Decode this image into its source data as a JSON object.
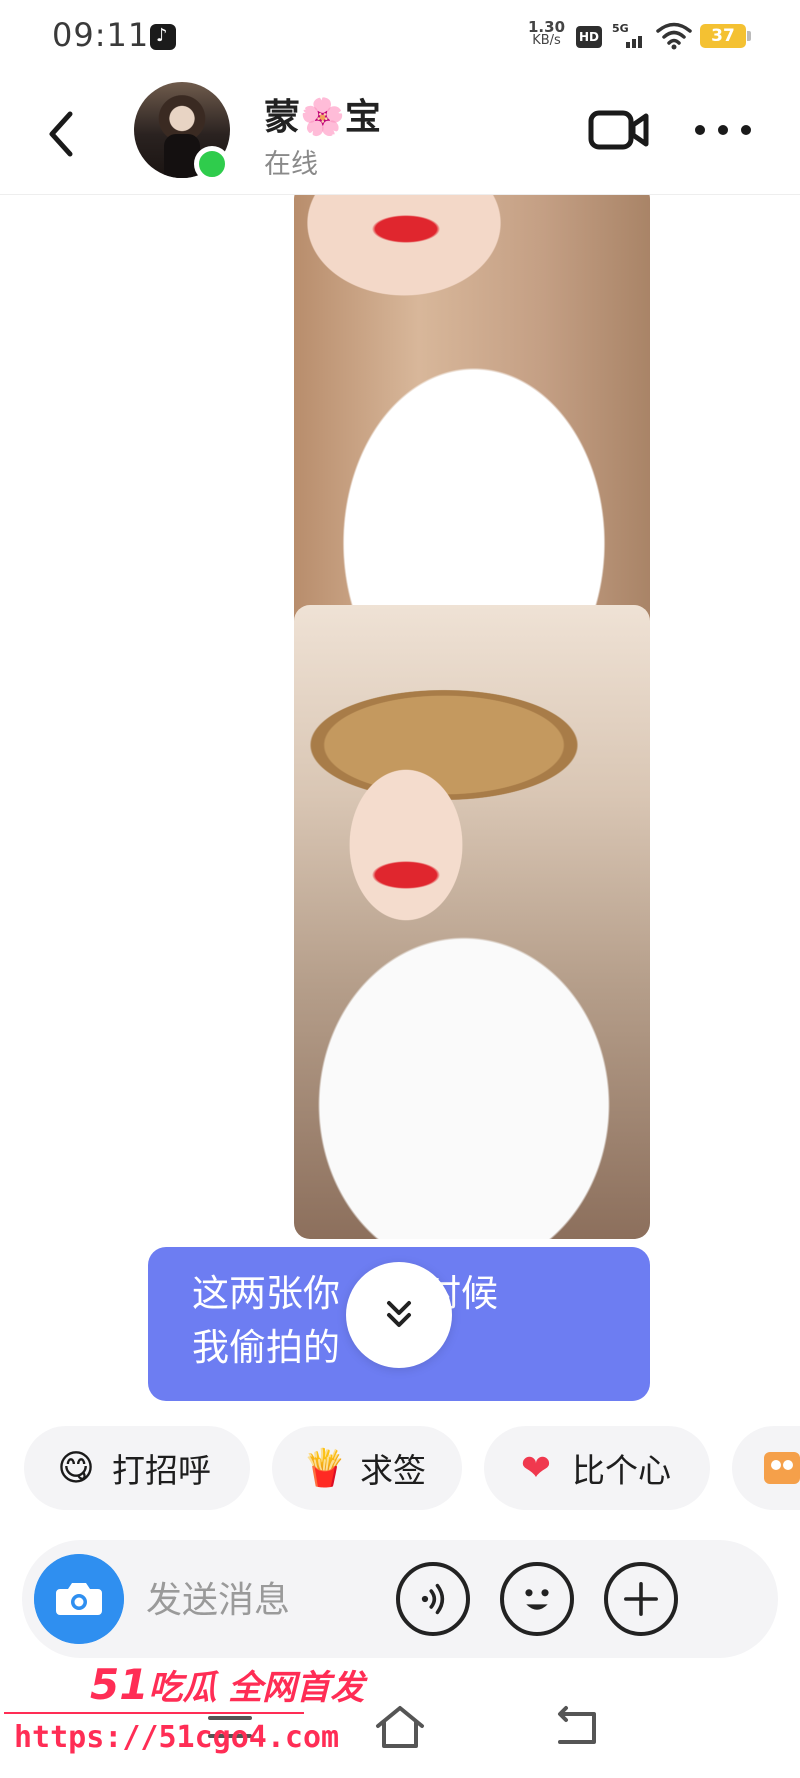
{
  "status_bar": {
    "time": "09:11",
    "net_speed_value": "1.30",
    "net_speed_unit": "KB/s",
    "hd_label": "HD",
    "signal_label": "5G",
    "battery": "37"
  },
  "header": {
    "contact_name": "蒙",
    "contact_name_mid": "🌸",
    "contact_name_end": "宝",
    "contact_status": "在线"
  },
  "chat": {
    "messages": [
      {
        "type": "image"
      },
      {
        "type": "image"
      },
      {
        "type": "text",
        "text": "这两张你    的时候\n我偷拍的"
      }
    ]
  },
  "quick_replies": [
    {
      "icon": "😋",
      "label": "打招呼"
    },
    {
      "icon": "🍟",
      "label": "求签"
    },
    {
      "icon": "❤",
      "label": "比个心"
    }
  ],
  "input": {
    "placeholder": "发送消息"
  },
  "watermark": {
    "brand_number": "51",
    "brand_text": "吃瓜 全网首发",
    "url": "https://51cgo4.com"
  },
  "colors": {
    "bubble": "#6d7df2",
    "online": "#2fcc4c",
    "camera": "#2f8ff0",
    "battery": "#f4c132",
    "watermark": "#ff2d55"
  }
}
